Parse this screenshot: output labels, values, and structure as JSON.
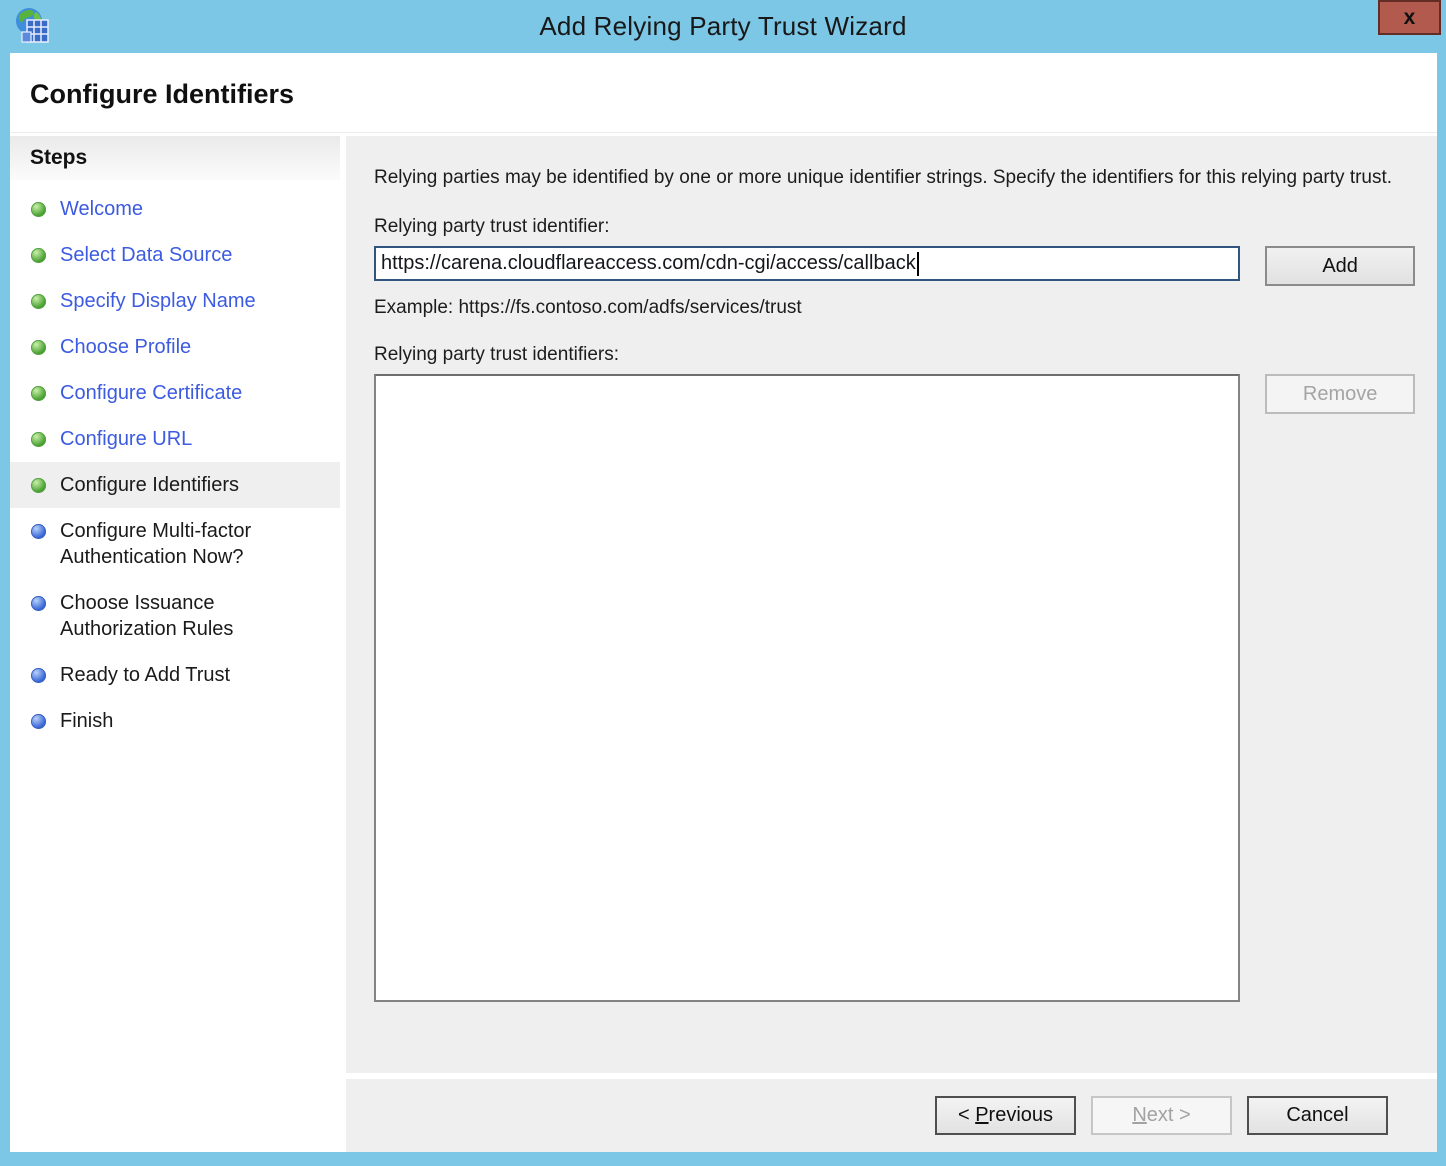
{
  "window": {
    "title": "Add Relying Party Trust Wizard",
    "close_glyph": "x"
  },
  "header": {
    "title": "Configure Identifiers"
  },
  "sidebar": {
    "title": "Steps",
    "items": [
      {
        "label": "Welcome",
        "state": "done"
      },
      {
        "label": "Select Data Source",
        "state": "done"
      },
      {
        "label": "Specify Display Name",
        "state": "done"
      },
      {
        "label": "Choose Profile",
        "state": "done"
      },
      {
        "label": "Configure Certificate",
        "state": "done"
      },
      {
        "label": "Configure URL",
        "state": "done"
      },
      {
        "label": "Configure Identifiers",
        "state": "current"
      },
      {
        "label": "Configure Multi-factor Authentication Now?",
        "state": "pending"
      },
      {
        "label": "Choose Issuance Authorization Rules",
        "state": "pending"
      },
      {
        "label": "Ready to Add Trust",
        "state": "pending"
      },
      {
        "label": "Finish",
        "state": "pending"
      }
    ]
  },
  "content": {
    "description": "Relying parties may be identified by one or more unique identifier strings. Specify the identifiers for this relying party trust.",
    "identifier_label": "Relying party trust identifier:",
    "identifier_value": "https://carena.cloudflareaccess.com/cdn-cgi/access/callback",
    "add_button": "Add",
    "example": "Example: https://fs.contoso.com/adfs/services/trust",
    "identifiers_list_label": "Relying party trust identifiers:",
    "identifiers": [],
    "remove_button": "Remove"
  },
  "footer": {
    "previous": {
      "pre": "< ",
      "mnemonic": "P",
      "rest": "revious"
    },
    "next": {
      "pre": "",
      "mnemonic": "N",
      "rest": "ext >"
    },
    "cancel": "Cancel"
  },
  "colors": {
    "titlebar_blue": "#7cc6e6",
    "close_button_red": "#b25a4e",
    "link_blue": "#3c5be0",
    "done_bullet_green": "#4da335",
    "pending_bullet_blue": "#3c6ad8",
    "focused_input_border": "#32557f",
    "panel_gray": "#efefef"
  }
}
